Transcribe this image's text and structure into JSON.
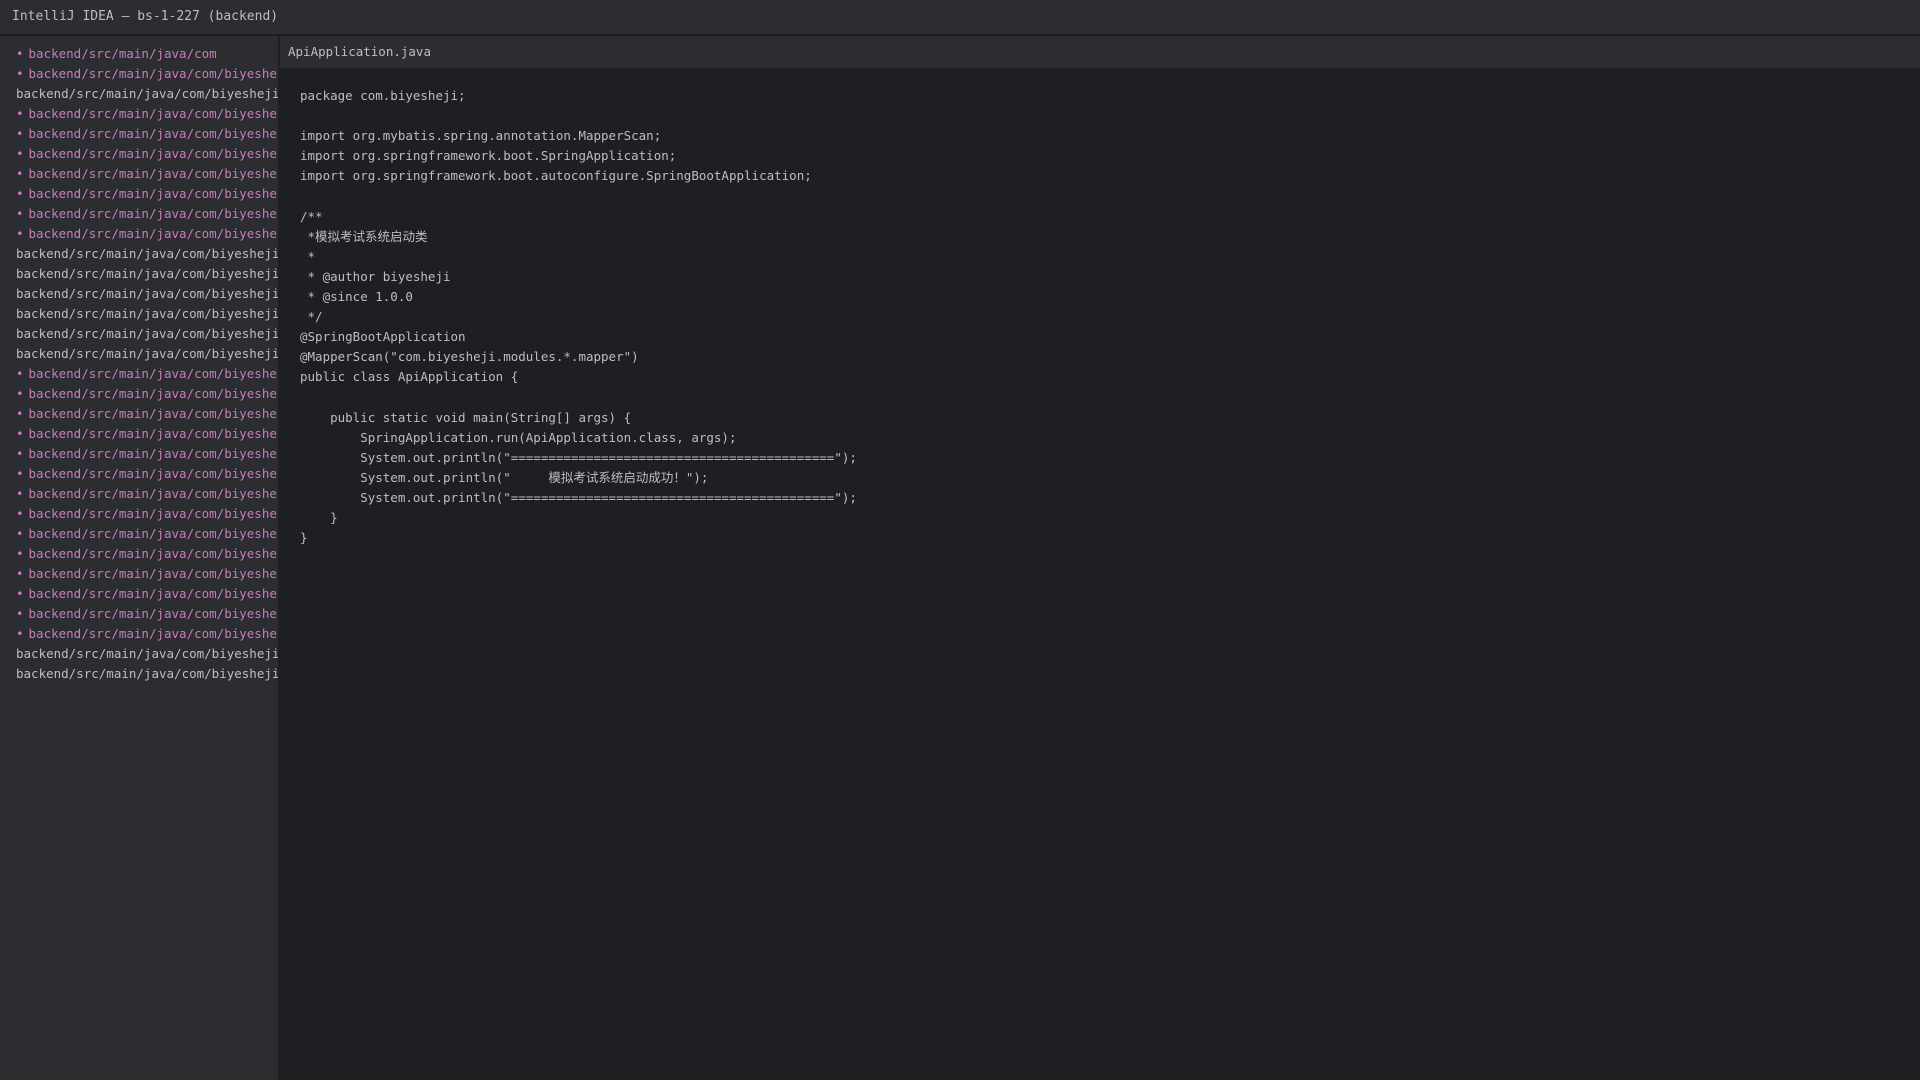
{
  "window": {
    "title": "IntelliJ IDEA — bs-1-227 (backend)"
  },
  "sidebar": {
    "items": [
      {
        "label": "backend/src/main/java/com",
        "modified": true
      },
      {
        "label": "backend/src/main/java/com/biyesheji",
        "modified": true
      },
      {
        "label": "backend/src/main/java/com/biyesheji/A",
        "modified": false
      },
      {
        "label": "backend/src/main/java/com/biyesheji",
        "modified": true
      },
      {
        "label": "backend/src/main/java/com/biyesheji",
        "modified": true
      },
      {
        "label": "backend/src/main/java/com/biyesheji",
        "modified": true
      },
      {
        "label": "backend/src/main/java/com/biyesheji",
        "modified": true
      },
      {
        "label": "backend/src/main/java/com/biyesheji",
        "modified": true
      },
      {
        "label": "backend/src/main/java/com/biyesheji",
        "modified": true
      },
      {
        "label": "backend/src/main/java/com/biyesheji",
        "modified": true
      },
      {
        "label": "backend/src/main/java/com/biyesheji/c",
        "modified": false
      },
      {
        "label": "backend/src/main/java/com/biyesheji/c",
        "modified": false
      },
      {
        "label": "backend/src/main/java/com/biyesheji/c",
        "modified": false
      },
      {
        "label": "backend/src/main/java/com/biyesheji/c",
        "modified": false
      },
      {
        "label": "backend/src/main/java/com/biyesheji/c",
        "modified": false
      },
      {
        "label": "backend/src/main/java/com/biyesheji/c",
        "modified": false
      },
      {
        "label": "backend/src/main/java/com/biyesheji",
        "modified": true
      },
      {
        "label": "backend/src/main/java/com/biyesheji",
        "modified": true
      },
      {
        "label": "backend/src/main/java/com/biyesheji",
        "modified": true
      },
      {
        "label": "backend/src/main/java/com/biyesheji",
        "modified": true
      },
      {
        "label": "backend/src/main/java/com/biyesheji",
        "modified": true
      },
      {
        "label": "backend/src/main/java/com/biyesheji",
        "modified": true
      },
      {
        "label": "backend/src/main/java/com/biyesheji",
        "modified": true
      },
      {
        "label": "backend/src/main/java/com/biyesheji",
        "modified": true
      },
      {
        "label": "backend/src/main/java/com/biyesheji",
        "modified": true
      },
      {
        "label": "backend/src/main/java/com/biyesheji",
        "modified": true
      },
      {
        "label": "backend/src/main/java/com/biyesheji",
        "modified": true
      },
      {
        "label": "backend/src/main/java/com/biyesheji",
        "modified": true
      },
      {
        "label": "backend/src/main/java/com/biyesheji",
        "modified": true
      },
      {
        "label": "backend/src/main/java/com/biyesheji",
        "modified": true
      },
      {
        "label": "backend/src/main/java/com/biyesheji/t",
        "modified": false
      },
      {
        "label": "backend/src/main/java/com/biyesheji/t",
        "modified": false
      }
    ],
    "bullet": "•"
  },
  "editor": {
    "tab_label": "ApiApplication.java",
    "lines": [
      "package com.biyesheji;",
      "",
      "import org.mybatis.spring.annotation.MapperScan;",
      "import org.springframework.boot.SpringApplication;",
      "import org.springframework.boot.autoconfigure.SpringBootApplication;",
      "",
      "/**",
      " *模拟考试系统启动类",
      " *",
      " * @author biyesheji",
      " * @since 1.0.0",
      " */",
      "@SpringBootApplication",
      "@MapperScan(\"com.biyesheji.modules.*.mapper\")",
      "public class ApiApplication {",
      "",
      "    public static void main(String[] args) {",
      "        SpringApplication.run(ApiApplication.class, args);",
      "        System.out.println(\"===========================================\");",
      "        System.out.println(\"     模拟考试系统启动成功！\");",
      "        System.out.println(\"===========================================\");",
      "    }",
      "}"
    ]
  },
  "colors": {
    "background": "#1e1f22",
    "panel": "#2b2d30",
    "text": "#bcbec4",
    "modified": "#c77dbb"
  }
}
